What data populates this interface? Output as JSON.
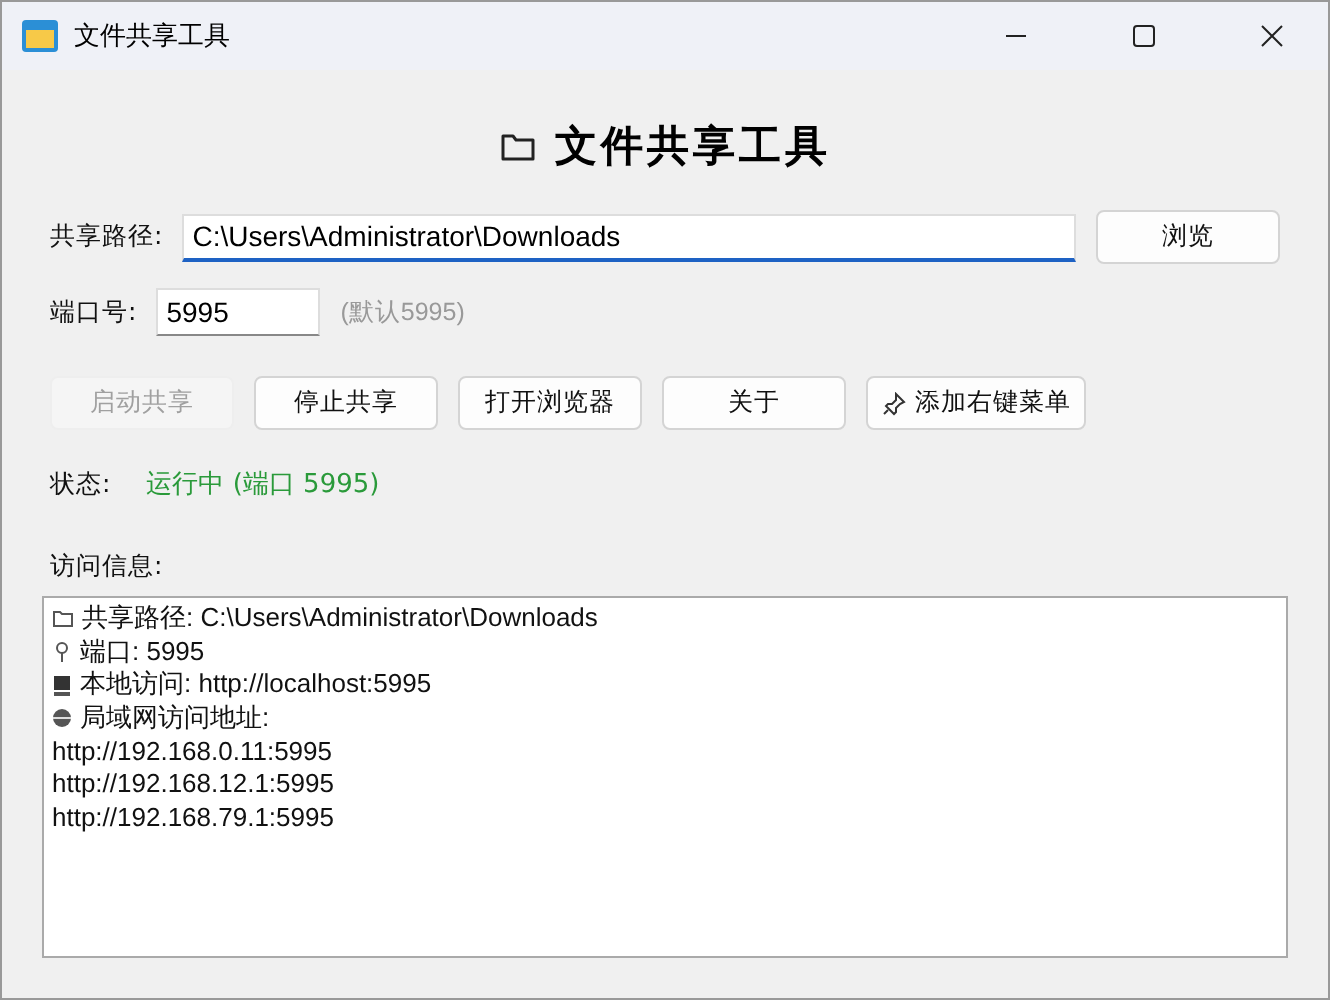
{
  "window": {
    "title": "文件共享工具"
  },
  "heading": "文件共享工具",
  "path": {
    "label": "共享路径:",
    "value": "C:\\Users\\Administrator\\Downloads",
    "browse": "浏览"
  },
  "port": {
    "label": "端口号:",
    "value": "5995",
    "hint": "(默认5995)"
  },
  "buttons": [
    {
      "label": "启动共享",
      "disabled": true
    },
    {
      "label": "停止共享",
      "disabled": false
    },
    {
      "label": "打开浏览器",
      "disabled": false
    },
    {
      "label": "关于",
      "disabled": false
    },
    {
      "label": "添加右键菜单",
      "disabled": false
    }
  ],
  "status": {
    "label": "状态:",
    "value": "运行中 (端口 5995)"
  },
  "info": {
    "label": "访问信息:",
    "lines": [
      "共享路径: C:\\Users\\Administrator\\Downloads",
      "端口: 5995",
      "本地访问: http://localhost:5995",
      "局域网访问地址:",
      "http://192.168.0.11:5995",
      "http://192.168.12.1:5995",
      "http://192.168.79.1:5995"
    ]
  }
}
